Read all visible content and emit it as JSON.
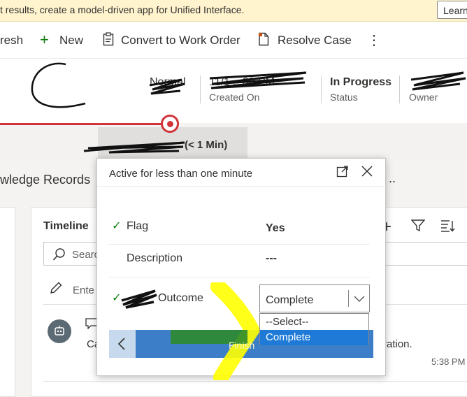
{
  "banner": {
    "text": "t results, create a model-driven app for Unified Interface.",
    "learn_label": "Learn"
  },
  "toolbar": {
    "refresh_label": "resh",
    "new_label": "New",
    "convert_label": "Convert to Work Order",
    "resolve_label": "Resolve Case",
    "more_label": "⋮"
  },
  "header": {
    "priority_value": "Normal",
    "created_on_value": "11/1 ...30 PM",
    "created_on_label": "Created On",
    "status_value": "In Progress",
    "status_label": "Status",
    "owner_label": "Owner"
  },
  "process": {
    "stage_duration": "(< 1 Min)"
  },
  "main": {
    "knowledge_label": "wledge Records",
    "more_dots": "..",
    "timeline_title": "Timeline",
    "search_placeholder": "Searc",
    "enter_note": "Ente",
    "activity_prefix": "Ca",
    "activity_suffix": "ration.",
    "activity_time": "5:38 PM"
  },
  "flyout": {
    "title": "Active for less than one minute",
    "rows": [
      {
        "label": "Flag",
        "value": "Yes",
        "checked": true
      },
      {
        "label": "Description",
        "value": "---",
        "checked": false
      },
      {
        "label": "Outcome",
        "checked": true
      }
    ],
    "select_value": "Complete",
    "options": [
      "--Select--",
      "Complete"
    ],
    "finish_label": "Finish"
  },
  "colors": {
    "accent": "#3c7fc8",
    "progress": "#d13438",
    "highlight": "#ffff00"
  }
}
